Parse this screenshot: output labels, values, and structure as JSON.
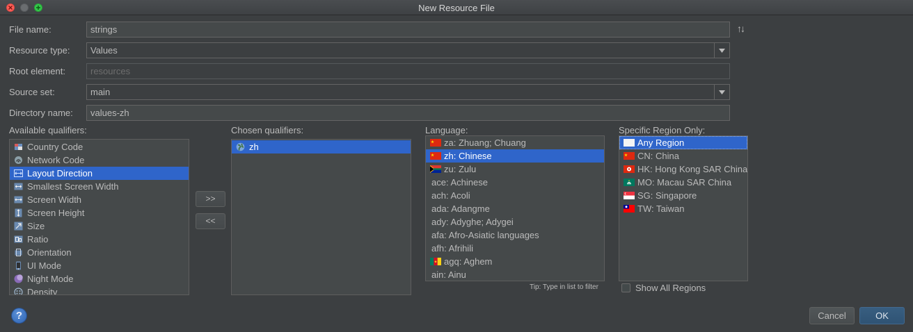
{
  "window": {
    "title": "New Resource File"
  },
  "form": {
    "file_name_label": "File name:",
    "file_name_value": "strings",
    "resource_type_label": "Resource type:",
    "resource_type_value": "Values",
    "root_element_label": "Root element:",
    "root_element_value": "resources",
    "source_set_label": "Source set:",
    "source_set_value": "main",
    "directory_name_label": "Directory name:",
    "directory_name_value": "values-zh"
  },
  "available": {
    "label": "Available qualifiers:",
    "items": [
      {
        "label": "Country Code",
        "icon": "country-code-icon"
      },
      {
        "label": "Network Code",
        "icon": "network-code-icon"
      },
      {
        "label": "Layout Direction",
        "icon": "layout-direction-icon",
        "selected": true
      },
      {
        "label": "Smallest Screen Width",
        "icon": "smallest-width-icon"
      },
      {
        "label": "Screen Width",
        "icon": "screen-width-icon"
      },
      {
        "label": "Screen Height",
        "icon": "screen-height-icon"
      },
      {
        "label": "Size",
        "icon": "size-icon"
      },
      {
        "label": "Ratio",
        "icon": "ratio-icon"
      },
      {
        "label": "Orientation",
        "icon": "orientation-icon"
      },
      {
        "label": "UI Mode",
        "icon": "ui-mode-icon"
      },
      {
        "label": "Night Mode",
        "icon": "night-mode-icon"
      },
      {
        "label": "Density",
        "icon": "density-icon"
      }
    ]
  },
  "move": {
    "add_label": ">>",
    "remove_label": "<<"
  },
  "chosen": {
    "label": "Chosen qualifiers:",
    "items": [
      {
        "label": "zh",
        "icon": "globe-icon",
        "selected": true
      }
    ]
  },
  "language": {
    "label": "Language:",
    "items": [
      {
        "label": "za: Zhuang; Chuang",
        "flag": "cn"
      },
      {
        "label": "zh: Chinese",
        "flag": "cn",
        "selected": true
      },
      {
        "label": "zu: Zulu",
        "flag": "za"
      },
      {
        "label": "ace: Achinese"
      },
      {
        "label": "ach: Acoli"
      },
      {
        "label": "ada: Adangme"
      },
      {
        "label": "ady: Adyghe; Adygei"
      },
      {
        "label": "afa: Afro-Asiatic languages"
      },
      {
        "label": "afh: Afrihili"
      },
      {
        "label": "agq: Aghem",
        "flag": "cm"
      },
      {
        "label": "ain: Ainu"
      }
    ],
    "tip": "Tip: Type in list to filter"
  },
  "region": {
    "label": "Specific Region Only:",
    "items": [
      {
        "label": "Any Region",
        "flag": "blank",
        "selected": true
      },
      {
        "label": "CN: China",
        "flag": "cn"
      },
      {
        "label": "HK: Hong Kong SAR China",
        "flag": "hk"
      },
      {
        "label": "MO: Macau SAR China",
        "flag": "mo"
      },
      {
        "label": "SG: Singapore",
        "flag": "sg"
      },
      {
        "label": "TW: Taiwan",
        "flag": "tw"
      }
    ],
    "show_all_label": "Show All Regions",
    "show_all_checked": false
  },
  "buttons": {
    "help": "?",
    "cancel": "Cancel",
    "ok": "OK"
  },
  "colors": {
    "selection": "#2f65ca",
    "background": "#3c3f41",
    "ok_button": "#365880"
  }
}
